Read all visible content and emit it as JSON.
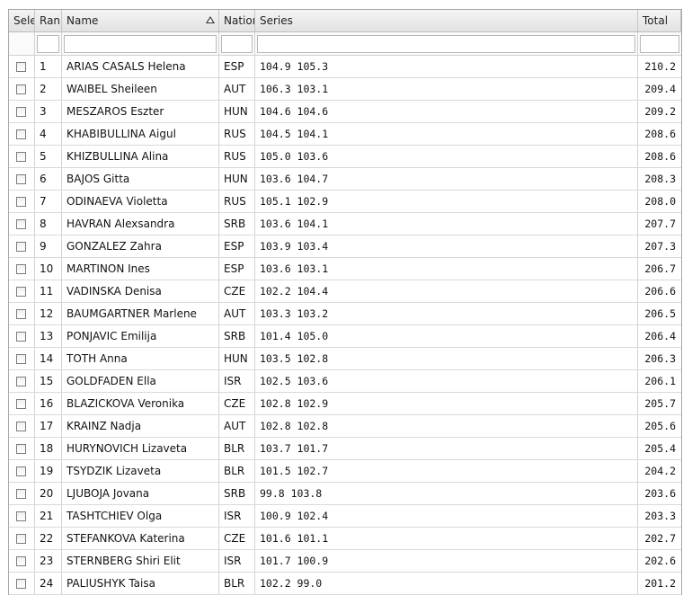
{
  "columns": {
    "select": "Select",
    "rank": "Rank",
    "name": "Name",
    "nation": "Nation",
    "series": "Series",
    "total": "Total"
  },
  "sort_icon": "sort-ascending-icon",
  "rows": [
    {
      "rank": "1",
      "name": "ARIAS CASALS Helena",
      "nation": "ESP",
      "series": "104.9 105.3",
      "total": "210.2"
    },
    {
      "rank": "2",
      "name": "WAIBEL Sheileen",
      "nation": "AUT",
      "series": "106.3 103.1",
      "total": "209.4"
    },
    {
      "rank": "3",
      "name": "MESZAROS Eszter",
      "nation": "HUN",
      "series": "104.6 104.6",
      "total": "209.2"
    },
    {
      "rank": "4",
      "name": "KHABIBULLINA Aigul",
      "nation": "RUS",
      "series": "104.5 104.1",
      "total": "208.6"
    },
    {
      "rank": "5",
      "name": "KHIZBULLINA Alina",
      "nation": "RUS",
      "series": "105.0 103.6",
      "total": "208.6"
    },
    {
      "rank": "6",
      "name": "BAJOS Gitta",
      "nation": "HUN",
      "series": "103.6 104.7",
      "total": "208.3"
    },
    {
      "rank": "7",
      "name": "ODINAEVA Violetta",
      "nation": "RUS",
      "series": "105.1 102.9",
      "total": "208.0"
    },
    {
      "rank": "8",
      "name": "HAVRAN Alexsandra",
      "nation": "SRB",
      "series": "103.6 104.1",
      "total": "207.7"
    },
    {
      "rank": "9",
      "name": "GONZALEZ Zahra",
      "nation": "ESP",
      "series": "103.9 103.4",
      "total": "207.3"
    },
    {
      "rank": "10",
      "name": "MARTINON Ines",
      "nation": "ESP",
      "series": "103.6 103.1",
      "total": "206.7"
    },
    {
      "rank": "11",
      "name": "VADINSKA Denisa",
      "nation": "CZE",
      "series": "102.2 104.4",
      "total": "206.6"
    },
    {
      "rank": "12",
      "name": "BAUMGARTNER Marlene",
      "nation": "AUT",
      "series": "103.3 103.2",
      "total": "206.5"
    },
    {
      "rank": "13",
      "name": "PONJAVIC Emilija",
      "nation": "SRB",
      "series": "101.4 105.0",
      "total": "206.4"
    },
    {
      "rank": "14",
      "name": "TOTH Anna",
      "nation": "HUN",
      "series": "103.5 102.8",
      "total": "206.3"
    },
    {
      "rank": "15",
      "name": "GOLDFADEN Ella",
      "nation": "ISR",
      "series": "102.5 103.6",
      "total": "206.1"
    },
    {
      "rank": "16",
      "name": "BLAZICKOVA Veronika",
      "nation": "CZE",
      "series": "102.8 102.9",
      "total": "205.7"
    },
    {
      "rank": "17",
      "name": "KRAINZ Nadja",
      "nation": "AUT",
      "series": "102.8 102.8",
      "total": "205.6"
    },
    {
      "rank": "18",
      "name": "HURYNOVICH Lizaveta",
      "nation": "BLR",
      "series": "103.7 101.7",
      "total": "205.4"
    },
    {
      "rank": "19",
      "name": "TSYDZIK Lizaveta",
      "nation": "BLR",
      "series": "101.5 102.7",
      "total": "204.2"
    },
    {
      "rank": "20",
      "name": "LJUBOJA Jovana",
      "nation": "SRB",
      "series": "99.8 103.8",
      "total": "203.6"
    },
    {
      "rank": "21",
      "name": "TASHTCHIEV Olga",
      "nation": "ISR",
      "series": "100.9 102.4",
      "total": "203.3"
    },
    {
      "rank": "22",
      "name": "STEFANKOVA Katerina",
      "nation": "CZE",
      "series": "101.6 101.1",
      "total": "202.7"
    },
    {
      "rank": "23",
      "name": "STERNBERG Shiri Elit",
      "nation": "ISR",
      "series": "101.7 100.9",
      "total": "202.6"
    },
    {
      "rank": "24",
      "name": "PALIUSHYK Taisa",
      "nation": "BLR",
      "series": "102.2 99.0",
      "total": "201.2"
    }
  ]
}
